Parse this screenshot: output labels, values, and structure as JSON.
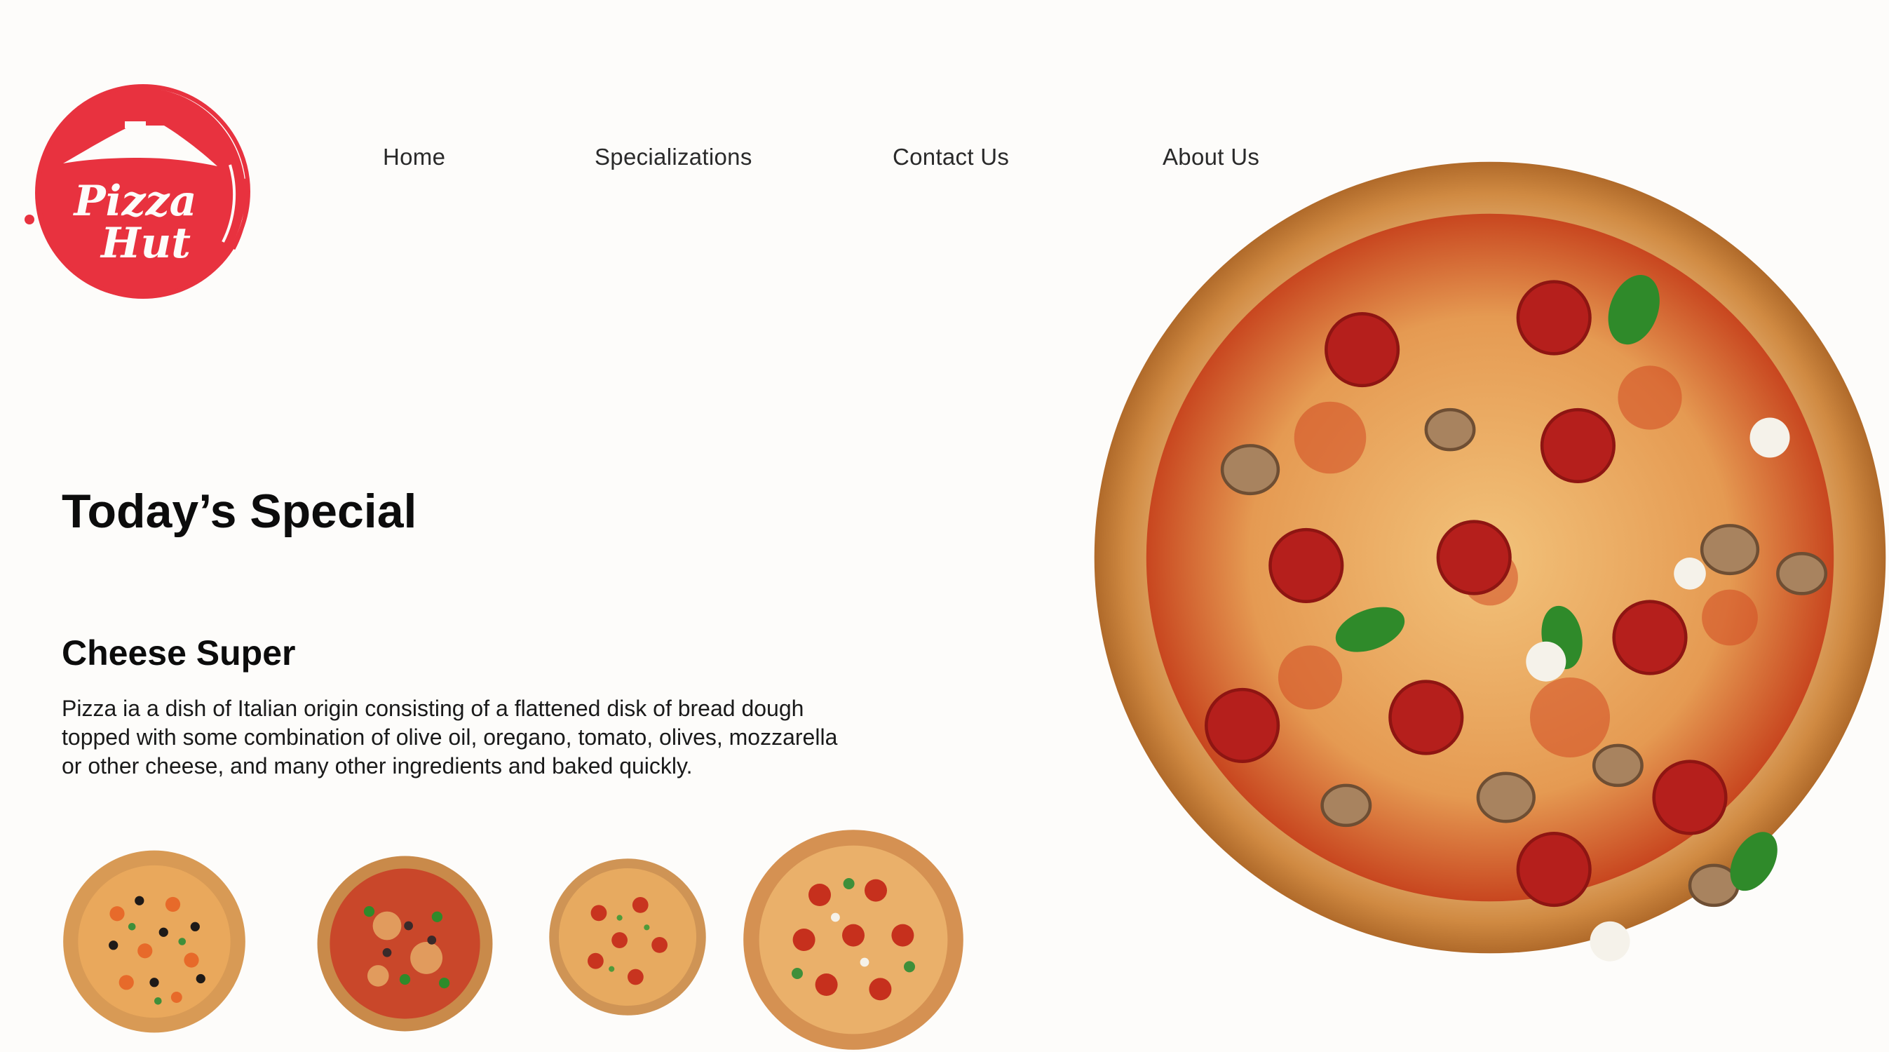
{
  "brand": {
    "logo_text_line1": "Pizza",
    "logo_text_line2": "Hut",
    "color": "#e8323f"
  },
  "nav": {
    "items": [
      {
        "label": "Home"
      },
      {
        "label": "Specializations"
      },
      {
        "label": "Contact Us"
      },
      {
        "label": "About Us"
      }
    ]
  },
  "special": {
    "title": "Today’s Special",
    "item_name": "Cheese Super",
    "description": "Pizza ia a dish of Italian origin consisting of a flattened disk of bread dough topped with some combination of olive oil, oregano, tomato, olives, mozzarella or other cheese, and many other ingredients and baked quickly."
  },
  "images": {
    "hero": "pepperoni-mushroom-pizza-image",
    "thumbnails": [
      "veggie-olive-pizza-thumbnail",
      "supreme-pizza-thumbnail",
      "thin-crust-pizza-thumbnail",
      "pepperoni-pizza-thumbnail"
    ]
  },
  "colors": {
    "background": "#fdfcfa",
    "crust": "#d9964f",
    "sauce": "#c6361d",
    "cheese": "#eaa85a",
    "pepperoni": "#b51f1c",
    "basil": "#2f8a2a",
    "mushroom": "#8c6a4a"
  }
}
